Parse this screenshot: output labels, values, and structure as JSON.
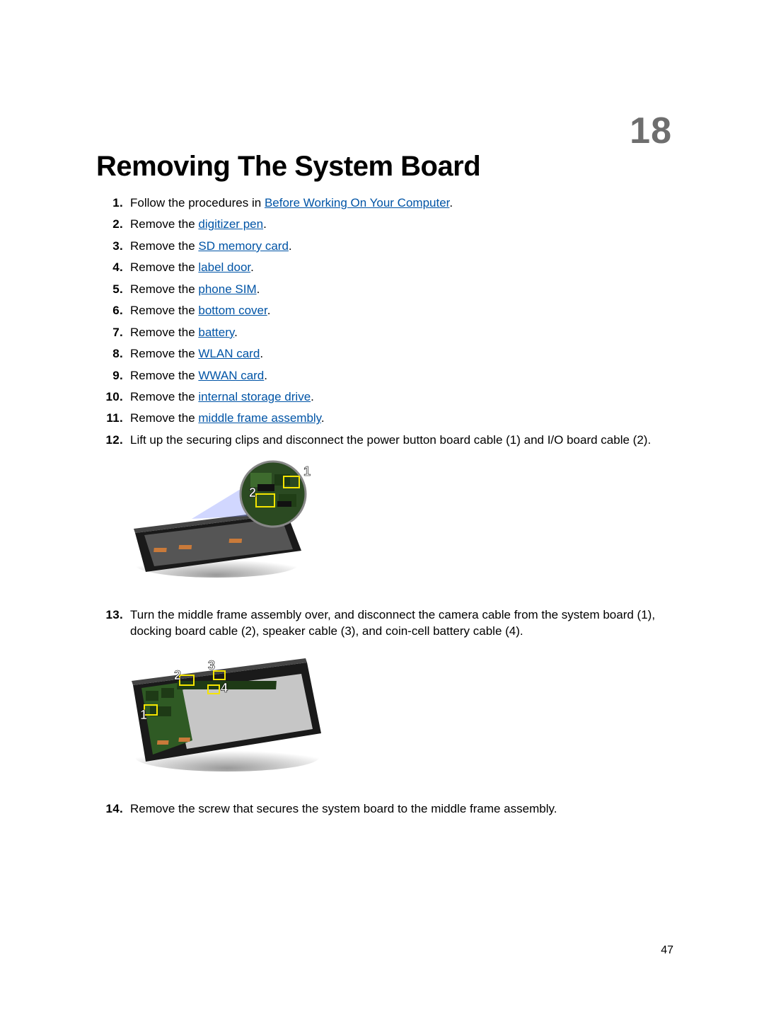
{
  "chapter_number": "18",
  "title": "Removing The System Board",
  "page_number": "47",
  "steps": [
    {
      "n": "1.",
      "pre": "Follow the procedures in ",
      "link": "Before Working On Your Computer",
      "post": "."
    },
    {
      "n": "2.",
      "pre": "Remove the ",
      "link": "digitizer pen",
      "post": "."
    },
    {
      "n": "3.",
      "pre": "Remove the ",
      "link": "SD memory card",
      "post": "."
    },
    {
      "n": "4.",
      "pre": "Remove the ",
      "link": "label door",
      "post": "."
    },
    {
      "n": "5.",
      "pre": "Remove the ",
      "link": "phone SIM",
      "post": "."
    },
    {
      "n": "6.",
      "pre": "Remove the ",
      "link": "bottom cover",
      "post": "."
    },
    {
      "n": "7.",
      "pre": "Remove the ",
      "link": "battery",
      "post": "."
    },
    {
      "n": "8.",
      "pre": "Remove the ",
      "link": "WLAN card",
      "post": "."
    },
    {
      "n": "9.",
      "pre": "Remove the ",
      "link": "WWAN card",
      "post": "."
    },
    {
      "n": "10.",
      "pre": "Remove the ",
      "link": "internal storage drive",
      "post": "."
    },
    {
      "n": "11.",
      "pre": "Remove the ",
      "link": "middle frame assembly",
      "post": "."
    },
    {
      "n": "12.",
      "text": "Lift up the securing clips and disconnect the power button board cable (1) and I/O board cable (2)."
    },
    {
      "n": "13.",
      "text": "Turn the middle frame assembly over, and disconnect the camera cable from the system board (1), docking board cable (2), speaker cable (3), and coin-cell battery cable (4)."
    },
    {
      "n": "14.",
      "text": "Remove the screw that secures the system board to the middle frame assembly."
    }
  ],
  "figure1_callouts": [
    "1",
    "2"
  ],
  "figure2_callouts": [
    "1",
    "2",
    "3",
    "4"
  ]
}
